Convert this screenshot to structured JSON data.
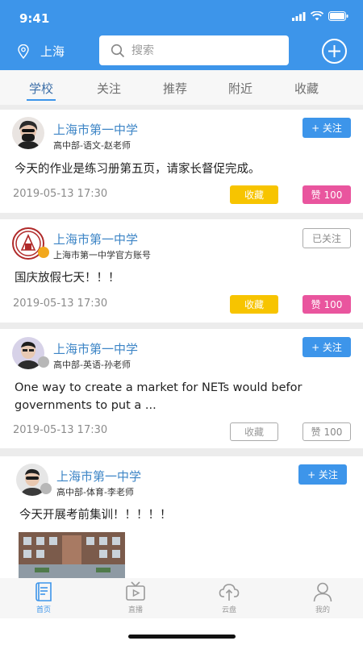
{
  "status_bar": {
    "time": "9:41"
  },
  "header": {
    "location": "上海",
    "search_placeholder": "搜索"
  },
  "tabs": [
    {
      "label": "学校",
      "active": true
    },
    {
      "label": "关注",
      "active": false
    },
    {
      "label": "推荐",
      "active": false
    },
    {
      "label": "附近",
      "active": false
    },
    {
      "label": "收藏",
      "active": false
    }
  ],
  "posts": [
    {
      "school": "上海市第一中学",
      "subtitle": "高中部-语文-赵老师",
      "follow_label": "+ 关注",
      "content": "今天的作业是练习册第五页，请家长督促完成。",
      "date": "2019-05-13 17:30",
      "fav_label": "收藏",
      "like_label": "赞 100"
    },
    {
      "school": "上海市第一中学",
      "subtitle": "上海市第一中学官方账号",
      "follow_label": "已关注",
      "content": "国庆放假七天！！！",
      "date": "2019-05-13 17:30",
      "fav_label": "收藏",
      "like_label": "赞 100"
    },
    {
      "school": "上海市第一中学",
      "subtitle": "高中部-英语-孙老师",
      "follow_label": "+ 关注",
      "content_line1": "One way to create a market for NETs would befor",
      "content_line2": "governments to put a ...",
      "date": "2019-05-13 17:30",
      "fav_label": "收藏",
      "like_label": "赞 100"
    },
    {
      "school": "上海市第一中学",
      "subtitle": "高中部-体育-李老师",
      "follow_label": "+ 关注",
      "content": "今天开展考前集训！！！！！"
    }
  ],
  "tabbar": [
    {
      "label": "首页",
      "icon": "home-doc-icon",
      "active": true
    },
    {
      "label": "直播",
      "icon": "tv-icon",
      "active": false
    },
    {
      "label": "云盘",
      "icon": "cloud-upload-icon",
      "active": false
    },
    {
      "label": "我的",
      "icon": "user-icon",
      "active": false
    }
  ],
  "colors": {
    "primary": "#3d95ea",
    "fav": "#f7c400",
    "like": "#e9559e"
  }
}
